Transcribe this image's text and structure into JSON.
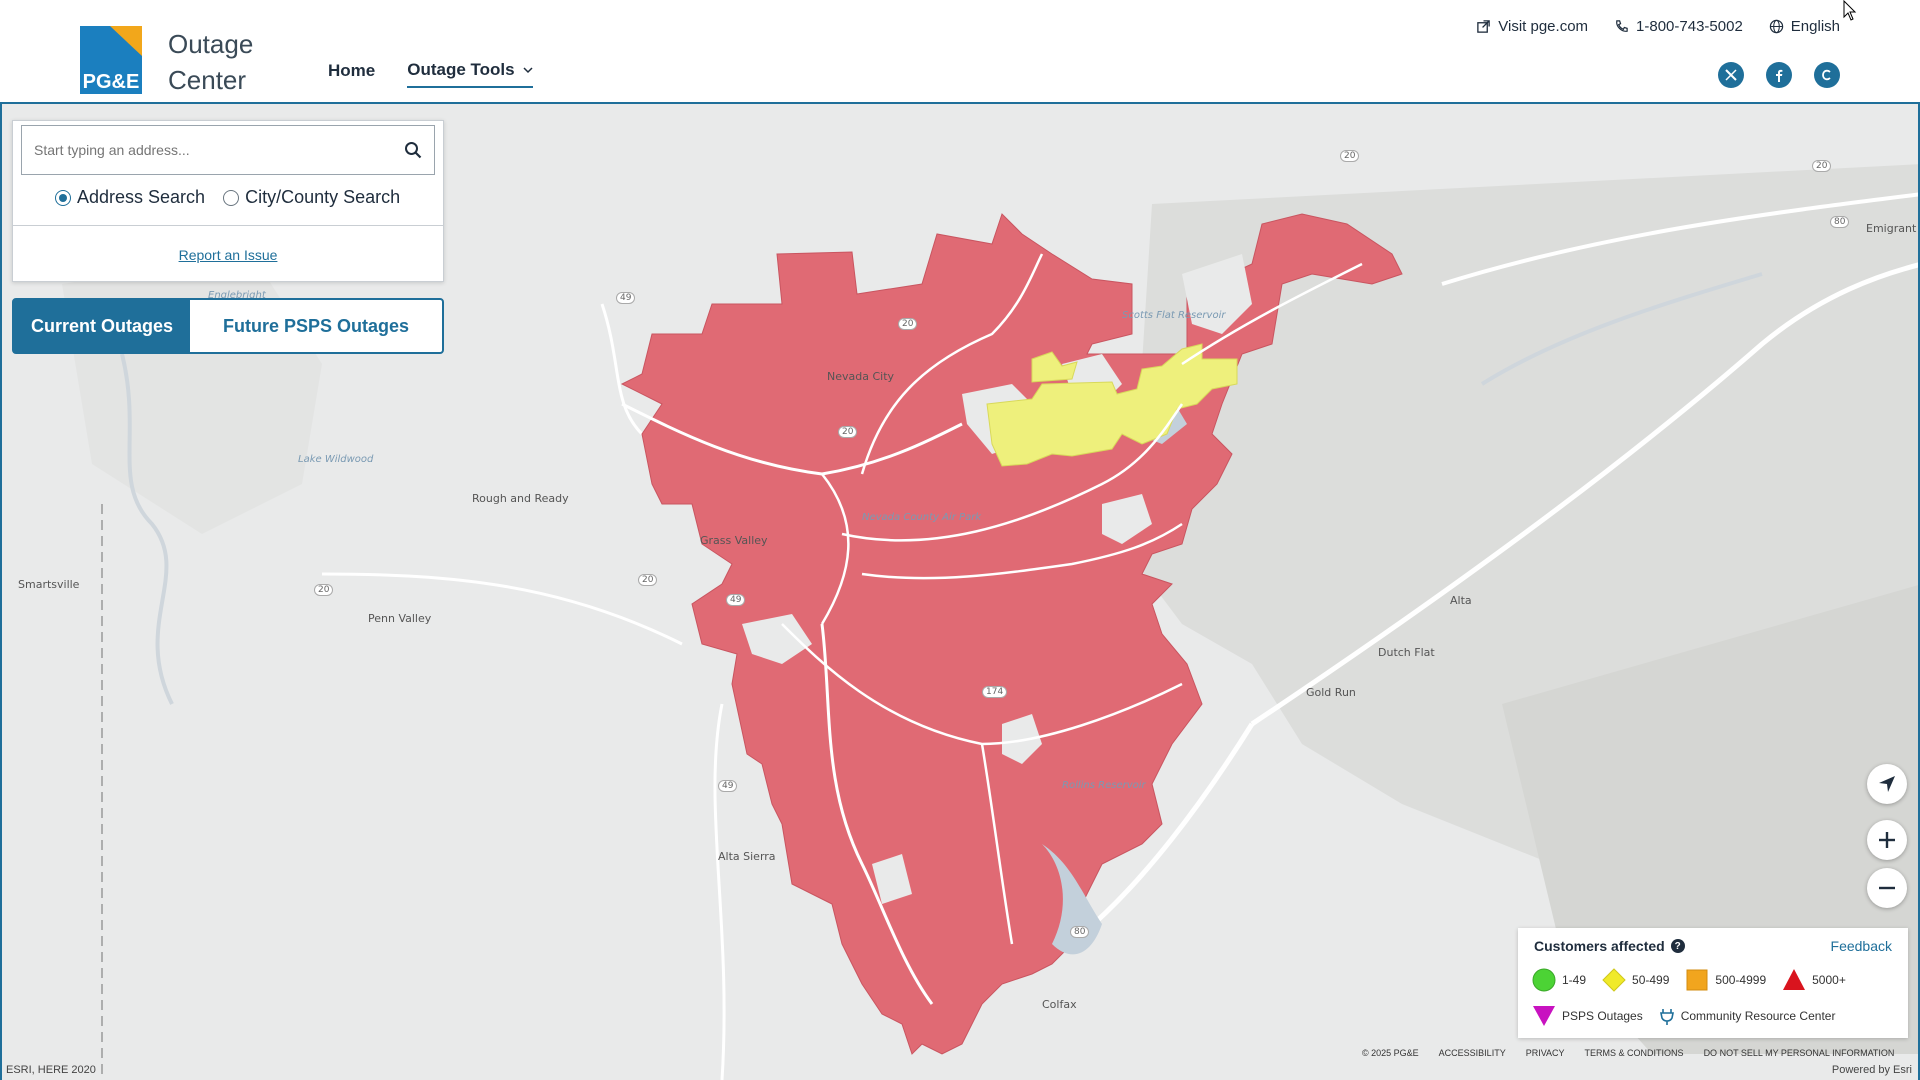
{
  "header": {
    "brand_line1": "Outage",
    "brand_line2": "Center",
    "logo_text": "PG&E",
    "nav": [
      {
        "label": "Home"
      },
      {
        "label": "Outage Tools"
      }
    ],
    "utility": {
      "visit": "Visit pge.com",
      "phone": "1-800-743-5002",
      "language": "English"
    },
    "social": [
      "x-icon",
      "facebook-icon",
      "c-icon"
    ]
  },
  "search": {
    "placeholder": "Start typing an address...",
    "options": [
      {
        "label": "Address Search",
        "selected": true
      },
      {
        "label": "City/County Search",
        "selected": false
      }
    ],
    "report_link": "Report an Issue"
  },
  "tabs": {
    "current": "Current Outages",
    "future": "Future PSPS Outages"
  },
  "map": {
    "places": {
      "nevada_city": "Nevada City",
      "grass_valley": "Grass Valley",
      "rough_and_ready": "Rough and Ready",
      "penn_valley": "Penn Valley",
      "smartsville": "Smartsville",
      "alta_sierra": "Alta Sierra",
      "colfax": "Colfax",
      "gold_run": "Gold Run",
      "dutch_flat": "Dutch Flat",
      "alta": "Alta",
      "emigrant": "Emigrant",
      "lake_wildwood": "Lake Wildwood",
      "englebright": "Englebright",
      "scotts_flat": "Scotts Flat Reservoir",
      "rollins": "Rollins Reservoir",
      "airpark": "Nevada County Air Park"
    },
    "highways": [
      "20",
      "49",
      "174",
      "80"
    ],
    "colors": {
      "outage_5000": "#e06a74",
      "outage_50_499": "#eef07c",
      "background": "#e9eaea"
    }
  },
  "legend": {
    "title": "Customers affected",
    "feedback": "Feedback",
    "ranges": [
      {
        "label": "1-49",
        "color": "#4cd335",
        "shape": "circle"
      },
      {
        "label": "50-499",
        "color": "#f0ea2a",
        "shape": "diamond"
      },
      {
        "label": "500-4999",
        "color": "#f1a51e",
        "shape": "square"
      },
      {
        "label": "5000+",
        "color": "#d9141e",
        "shape": "triangle"
      }
    ],
    "psps": "PSPS Outages",
    "psps_color": "#c812c0",
    "crc": "Community Resource Center"
  },
  "footer": {
    "copyright": "© 2025 PG&E",
    "links": [
      "Accessibility",
      "Privacy",
      "Terms & Conditions",
      "Do not sell my personal information"
    ],
    "attribution": "ESRI, HERE 2020",
    "powered": "Powered by Esri"
  }
}
